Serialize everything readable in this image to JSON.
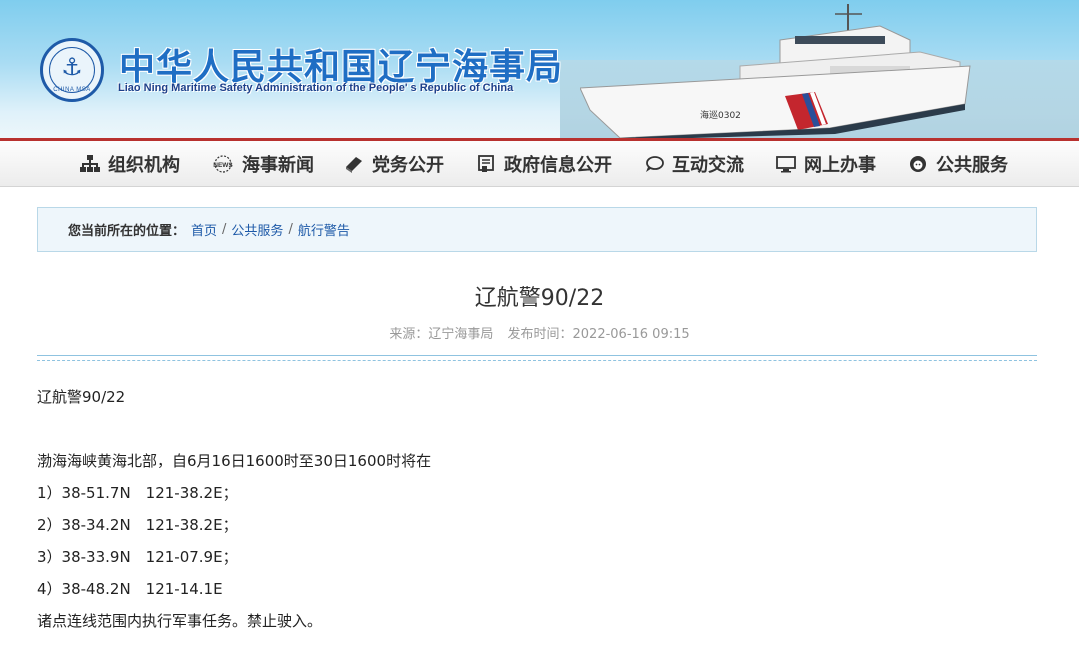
{
  "header": {
    "logo_text": "CHINA MSA",
    "site_title": "中华人民共和国辽宁海事局",
    "site_subtitle": "Liao Ning Maritime Safety Administration of the People' s Republic of China",
    "ship_label": "海巡0302"
  },
  "nav": {
    "items": [
      {
        "label": "组织机构",
        "icon": "org-chart-icon"
      },
      {
        "label": "海事新闻",
        "icon": "news-icon"
      },
      {
        "label": "党务公开",
        "icon": "book-icon"
      },
      {
        "label": "政府信息公开",
        "icon": "document-icon"
      },
      {
        "label": "互动交流",
        "icon": "chat-icon"
      },
      {
        "label": "网上办事",
        "icon": "monitor-icon"
      },
      {
        "label": "公共服务",
        "icon": "service-icon"
      }
    ],
    "news_icon_text": "NEWS"
  },
  "breadcrumb": {
    "lead": "您当前所在的位置：",
    "items": [
      "首页",
      "公共服务",
      "航行警告"
    ],
    "separator": "/"
  },
  "article": {
    "title": "辽航警90/22",
    "source": "来源：辽宁海事局",
    "publish_time": "发布时间：2022-06-16 09:15",
    "lines": [
      "辽航警90/22",
      "",
      "渤海海峡黄海北部，自6月16日1600时至30日1600时将在",
      "1）38-51.7N　121-38.2E；",
      "2）38-34.2N　121-38.2E；",
      "3）38-33.9N　121-07.9E；",
      "4）38-48.2N　121-14.1E",
      "诸点连线范围内执行军事任务。禁止驶入。"
    ]
  },
  "colors": {
    "title_blue": "#1f6ec4",
    "nav_accent_red": "#b8312f",
    "link_blue": "#1e5aa8",
    "breadcrumb_bg": "#eef6fb"
  }
}
